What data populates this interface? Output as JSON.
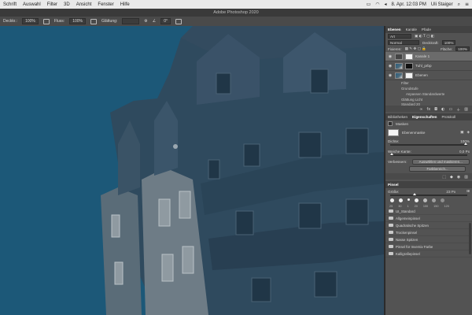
{
  "menubar": {
    "items": [
      "Schrift",
      "Auswahl",
      "Filter",
      "3D",
      "Ansicht",
      "Fenster",
      "Hilfe"
    ],
    "datetime": "8. Apr.  12:03 PM",
    "user": "Uli Staiger"
  },
  "window": {
    "title": "Adobe Photoshop 2020"
  },
  "options": {
    "deckkraft_label": "Deckkr.:",
    "deckkraft_value": "100%",
    "fluss_label": "Fluss:",
    "fluss_value": "100%",
    "glaettung_label": "Glättung:",
    "angle_value": "0°"
  },
  "layers_panel": {
    "tabs": [
      "Ebenen",
      "Kanäle",
      "Pfade"
    ],
    "kind_label": "Art",
    "blend_mode": "Normal",
    "opacity_label": "Deckkraft:",
    "opacity_value": "100%",
    "fix_label": "Fixieren:",
    "fill_label": "Fläche:",
    "fill_value": "100%",
    "layers": [
      {
        "name": "Kanale 1",
        "thumb": "white"
      },
      {
        "name": "Tuhl_prbp",
        "thumb": "photo"
      },
      {
        "name": "Ebenen",
        "thumb": "photo"
      }
    ],
    "sub_items": [
      "Filter",
      "Grundstufe",
      "Anpassen Standardwerte",
      "Glättung Licht",
      "Standard 20"
    ]
  },
  "properties_panel": {
    "tabs": [
      "Bibliotheken",
      "Eigenschaften",
      "Protokoll"
    ],
    "type_label": "Masken",
    "mask_label": "Ebenenmaske",
    "dichte_label": "Dichte:",
    "dichte_value": "100%",
    "weiche_label": "Weiche Kante:",
    "weiche_value": "0,0 Px",
    "verbessern_label": "Verbessern:",
    "button_select": "Auswählen und maskieren...",
    "button_color": "Farbbereich..."
  },
  "brush_panel": {
    "title": "Pinsel",
    "size_label": "Größe:",
    "size_value": "23 Px",
    "presets": [
      "25",
      "30",
      "1",
      "20",
      "100",
      "150",
      "120"
    ],
    "folders": [
      "UI_Standard",
      "Allgemeinpinsel",
      "Quadratische Spitzen",
      "Trockenpinsel",
      "Nasse Spitzen",
      "Pinsel für Inversiv Farbe",
      "Kalligrafiepinsel"
    ]
  },
  "colors": {
    "sky": "#1c5878",
    "panel": "#535353",
    "menubar": "#e9e9e9"
  }
}
